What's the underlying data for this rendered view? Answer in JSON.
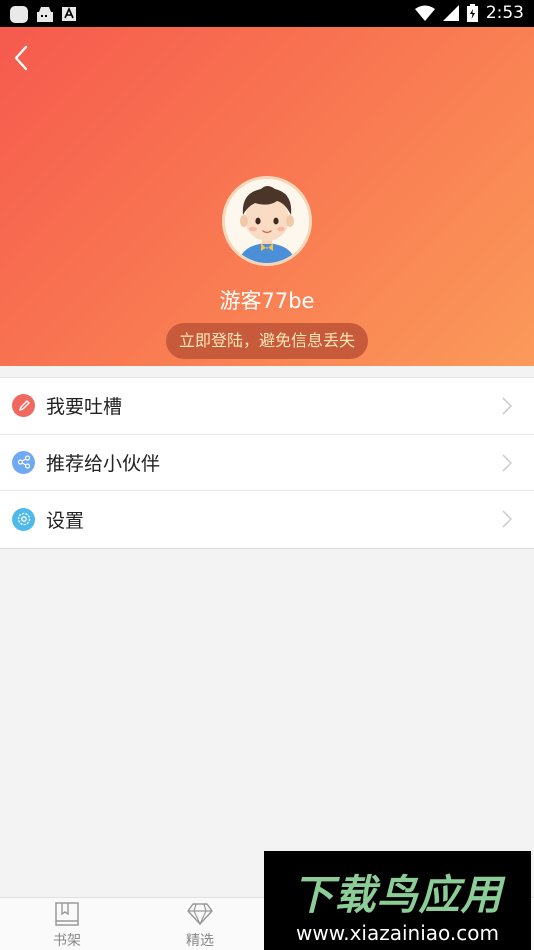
{
  "status_bar": {
    "time": "2:53",
    "icons": [
      "notification-icon",
      "shop-icon",
      "text-icon",
      "wifi-icon",
      "signal-icon",
      "battery-icon"
    ]
  },
  "profile": {
    "username": "游客77be",
    "login_prompt": "立即登陆，避免信息丢失"
  },
  "menu": [
    {
      "label": "我要吐槽",
      "icon": "pencil-icon",
      "color": "#f0685e"
    },
    {
      "label": "推荐给小伙伴",
      "icon": "share-icon",
      "color": "#6fa8f3"
    },
    {
      "label": "设置",
      "icon": "settings-icon",
      "color": "#4fb9ea"
    }
  ],
  "tabs": [
    {
      "label": "书架",
      "icon": "bookshelf-icon"
    },
    {
      "label": "精选",
      "icon": "diamond-icon"
    }
  ],
  "watermark": {
    "title": "下载鸟应用",
    "url": "www.xiazainiao.com"
  },
  "colors": {
    "header_start": "#f65a4e",
    "header_end": "#fb9a5a",
    "pill_bg": "#c75a3b",
    "pill_text": "#fde7b7"
  }
}
